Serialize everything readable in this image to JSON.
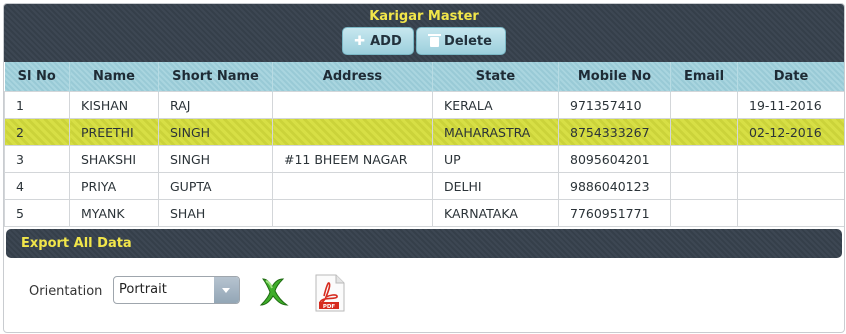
{
  "header": {
    "title": "Karigar Master"
  },
  "toolbar": {
    "add_label": "ADD",
    "delete_label": "Delete"
  },
  "table": {
    "columns": [
      "Sl No",
      "Name",
      "Short Name",
      "Address",
      "State",
      "Mobile No",
      "Email",
      "Date"
    ],
    "rows": [
      [
        "1",
        "KISHAN",
        "RAJ",
        "",
        "KERALA",
        "971357410",
        "",
        "19-11-2016"
      ],
      [
        "2",
        "PREETHI",
        "SINGH",
        "",
        "MAHARASTRA",
        "8754333267",
        "",
        "02-12-2016"
      ],
      [
        "3",
        "SHAKSHI",
        "SINGH",
        "#11 BHEEM NAGAR",
        "UP",
        "8095604201",
        "",
        ""
      ],
      [
        "4",
        "PRIYA",
        "GUPTA",
        "",
        "DELHI",
        "9886040123",
        "",
        ""
      ],
      [
        "5",
        "MYANK",
        "SHAH",
        "",
        "KARNATAKA",
        "7760951771",
        "",
        ""
      ]
    ],
    "selected_row": 2
  },
  "export": {
    "title": "Export All Data",
    "orientation_label": "Orientation",
    "orientation_value": "Portrait",
    "icons": [
      "excel-export-icon",
      "pdf-export-icon"
    ]
  },
  "colors": {
    "header_bg": "#3a444f",
    "title_yellow": "#f2e64a",
    "column_header": "#a9d5df",
    "selected_row": "#d7df45"
  }
}
